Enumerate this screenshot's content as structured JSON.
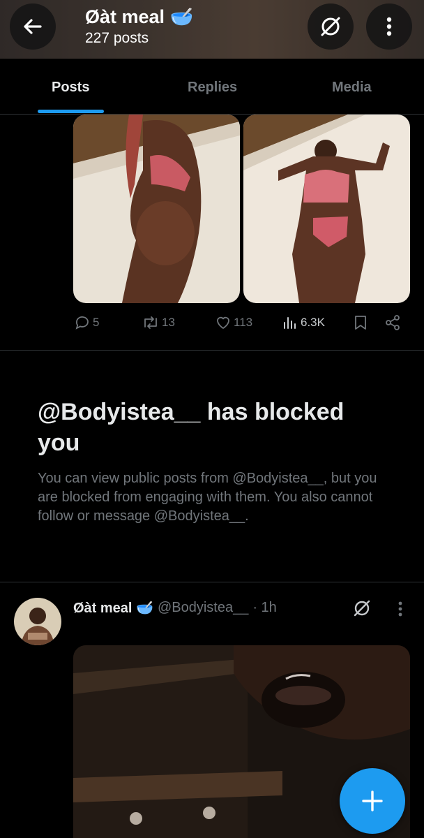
{
  "header": {
    "title": "Øàt meal 🥣",
    "subtitle": "227 posts",
    "icons": {
      "back": "arrow-left-icon",
      "unblock": "unblock-icon",
      "more": "more-vertical-icon"
    }
  },
  "tabs": [
    {
      "label": "Posts",
      "active": true
    },
    {
      "label": "Replies",
      "active": false
    },
    {
      "label": "Media",
      "active": false
    }
  ],
  "post1": {
    "media": [
      {
        "alt_icon": "photo-icon"
      },
      {
        "alt_icon": "photo-icon"
      }
    ],
    "actions": {
      "replies": "5",
      "reposts": "13",
      "likes": "113",
      "views": "6.3K"
    }
  },
  "blocked_notice": {
    "title": "@Bodyistea__ has blocked you",
    "body": "You can view public posts from @Bodyistea__, but you are blocked from engaging with them. You also cannot follow or message @Bodyistea__."
  },
  "post2": {
    "display_name": "Øàt meal 🥣",
    "handle": "@Bodyistea__",
    "time": "· 1h"
  },
  "colors": {
    "accent": "#1d9bf0",
    "muted": "#71767b",
    "text": "#e7e9ea",
    "background": "#000000"
  }
}
